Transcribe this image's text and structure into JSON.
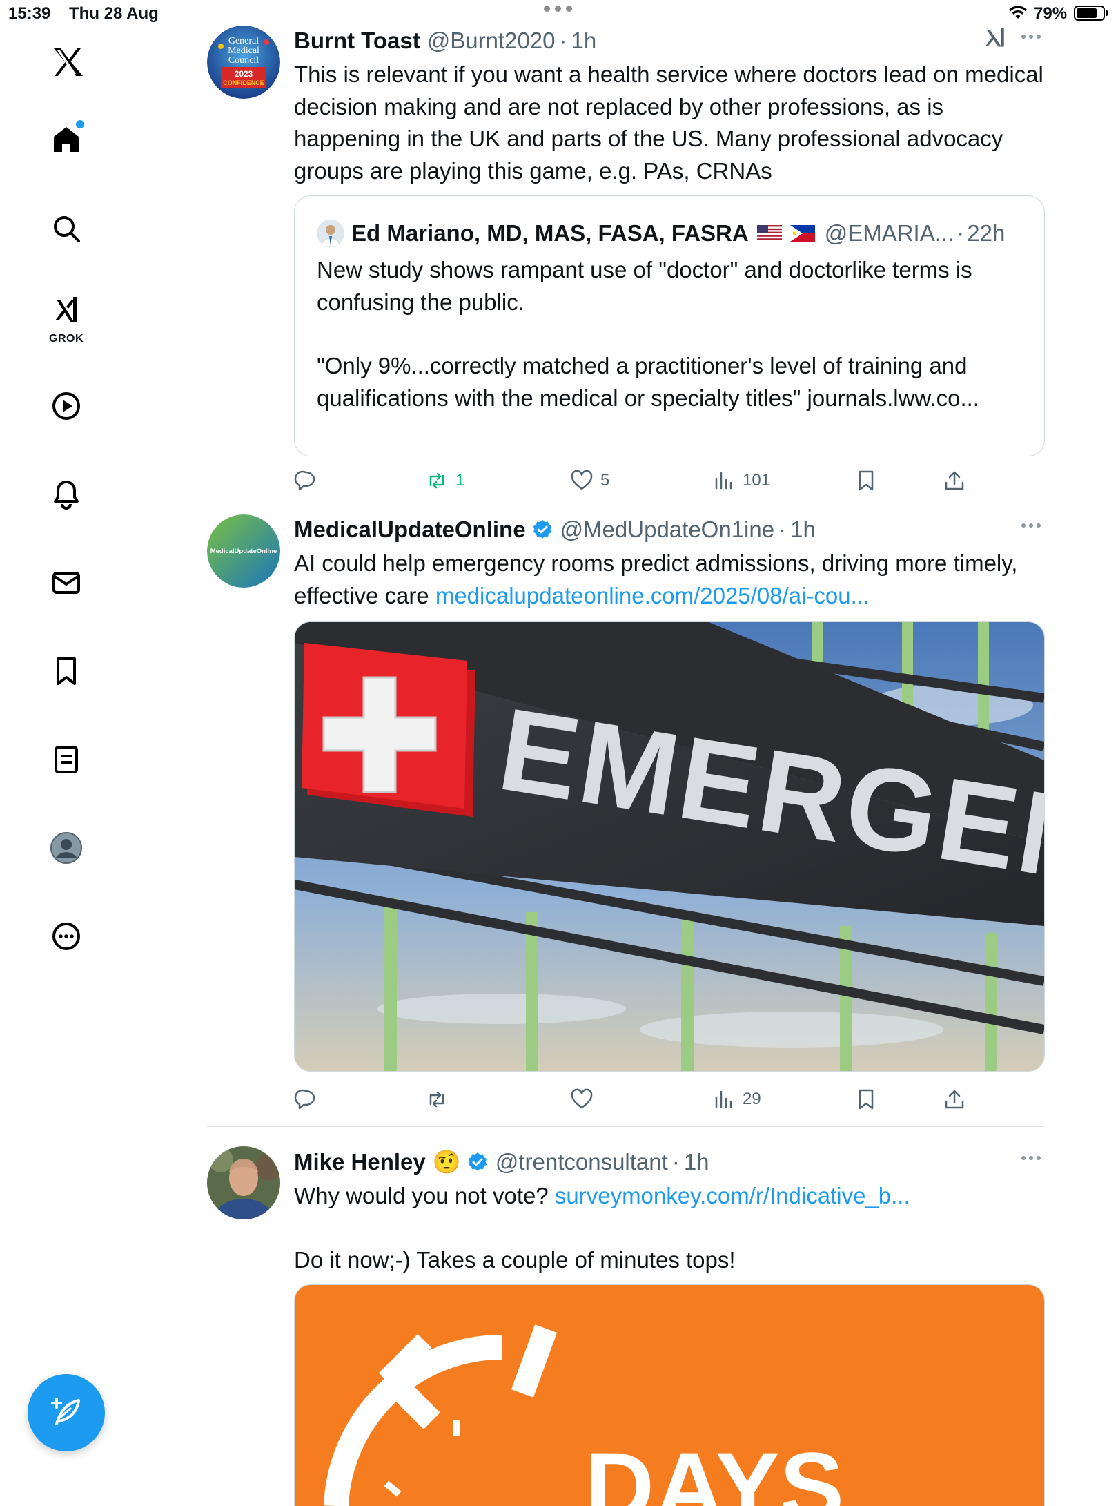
{
  "status_bar": {
    "time": "15:39",
    "date": "Thu 28 Aug",
    "battery": "79%",
    "battery_level": 0.79
  },
  "sidebar": {
    "items": [
      {
        "id": "x-logo"
      },
      {
        "id": "home",
        "has_notification_dot": true
      },
      {
        "id": "search"
      },
      {
        "id": "grok",
        "label": "GROK"
      },
      {
        "id": "video"
      },
      {
        "id": "notifications"
      },
      {
        "id": "messages"
      },
      {
        "id": "bookmarks"
      },
      {
        "id": "lists"
      },
      {
        "id": "profile"
      },
      {
        "id": "more"
      }
    ],
    "compose_icon": "compose-feather-icon"
  },
  "tweets": [
    {
      "name": "Burnt Toast",
      "handle": "@Burnt2020",
      "time": "1h",
      "text": "This is relevant if you want a health service where doctors lead on medical decision making and are not replaced by other professions, as is happening in the UK and parts of the US. Many professional advocacy groups are playing this game, e.g. PAs, CRNAs",
      "avatar_text": [
        "General",
        "Medical",
        "Council",
        "2023",
        "CONFIDENCE"
      ],
      "quote": {
        "name": "Ed Mariano, MD, MAS, FASA, FASRA",
        "handle": "@EMARIA...",
        "time": "22h",
        "text_1": "New study shows rampant use of \"doctor\" and doctorlike terms is confusing the public.",
        "text_2": "\"Only 9%...correctly matched a practitioner's level of training and qualifications with the medical or specialty titles\" journals.lww.co..."
      },
      "actions": {
        "replies": "",
        "reposts": "1",
        "likes": "5",
        "views": "101"
      }
    },
    {
      "name": "MedicalUpdateOnline",
      "handle": "@MedUpdateOn1ine",
      "time": "1h",
      "verified": true,
      "text": "AI could help emergency rooms predict admissions, driving more timely, effective care ",
      "link": "medicalupdateonline.com/2025/08/ai-cou...",
      "avatar_text": "MedicalUpdateOnline",
      "media_sign": "EMERGENCY",
      "actions": {
        "replies": "",
        "reposts": "",
        "likes": "",
        "views": "29"
      }
    },
    {
      "name": "Mike Henley",
      "emoji": "🤨",
      "handle": "@trentconsultant",
      "time": "1h",
      "verified": true,
      "text_1": "Why would you not vote? ",
      "link": "surveymonkey.com/r/Indicative_b...",
      "text_2": "Do it now;-) Takes a couple of minutes tops!",
      "media_text": "DAYS"
    }
  ],
  "colors": {
    "accent": "#1d9bf0",
    "repost_active": "#00ba7c",
    "muted": "#536471"
  }
}
